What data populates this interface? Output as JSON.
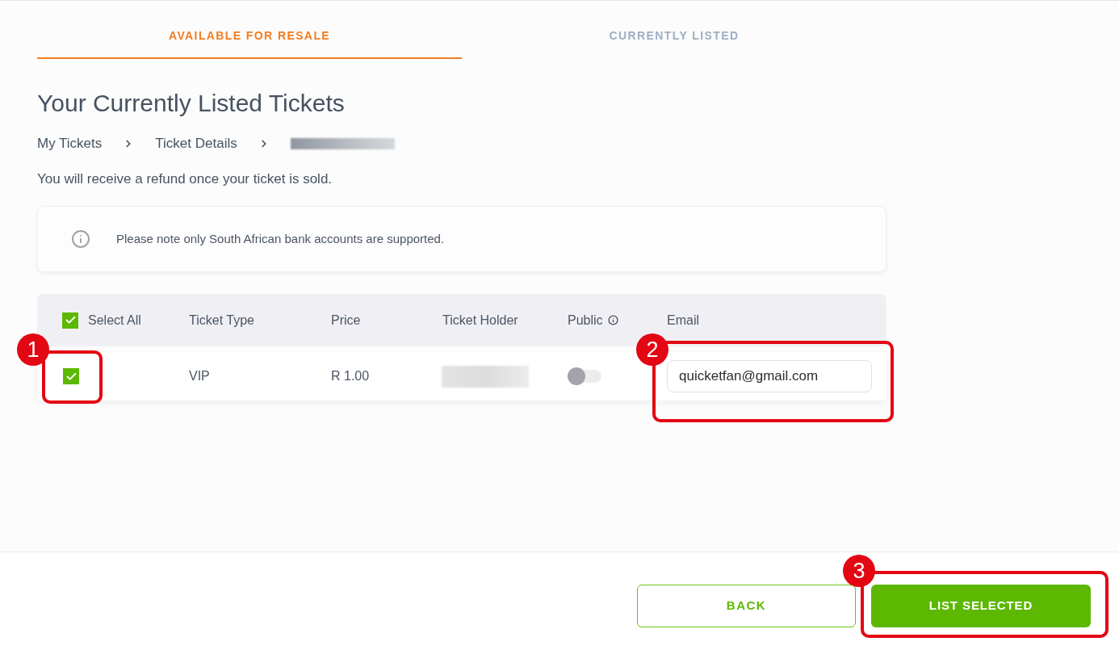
{
  "tabs": [
    {
      "label": "AVAILABLE FOR RESALE",
      "selected": true
    },
    {
      "label": "CURRENTLY LISTED",
      "selected": false
    }
  ],
  "heading": "Your Currently Listed Tickets",
  "breadcrumb": [
    {
      "kind": "link",
      "label": "My Tickets"
    },
    {
      "kind": "link",
      "label": "Ticket Details"
    },
    {
      "kind": "redacted"
    }
  ],
  "refund_note": "You will receive a refund once your ticket is sold.",
  "notice": {
    "text": "Please note only South African bank accounts are supported."
  },
  "table": {
    "select_all": {
      "label": "Select All",
      "checked": true
    },
    "columns": [
      {
        "label": "Ticket Type",
        "info": false
      },
      {
        "label": "Price",
        "info": false
      },
      {
        "label": "Ticket Holder",
        "info": false
      },
      {
        "label": "Public",
        "info": true
      },
      {
        "label": "Email",
        "info": false
      }
    ],
    "rows": [
      {
        "checked": true,
        "checkbox_callout": "1",
        "ticket_type": "VIP",
        "price": "R 1.00",
        "ticket_holder_redacted": true,
        "public": false,
        "email": "quicketfan@gmail.com",
        "email_callout": "2"
      }
    ]
  },
  "buttons": [
    {
      "kind": "outline",
      "label": "BACK"
    },
    {
      "kind": "primary",
      "label": "LIST SELECTED",
      "callout": "3"
    }
  ]
}
